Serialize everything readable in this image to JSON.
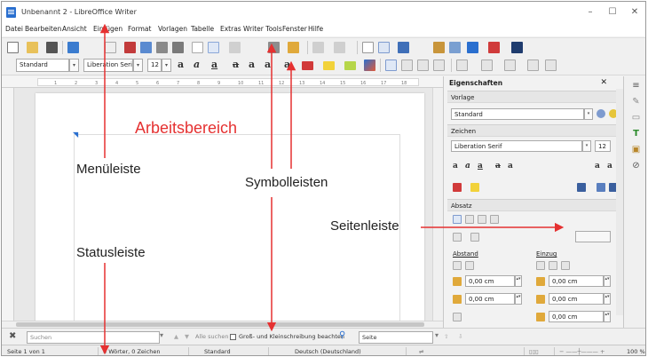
{
  "window": {
    "title": "Unbenannt 2 - LibreOffice Writer",
    "minimize": "–",
    "maximize": "☐",
    "close": "✕"
  },
  "menubar": {
    "items": [
      "Datei",
      "Bearbeiten",
      "Ansicht",
      "Einfügen",
      "Format",
      "Vorlagen",
      "Tabelle",
      "Extras",
      "Writer Tools",
      "Fenster",
      "Hilfe"
    ]
  },
  "format_toolbar": {
    "paragraph_style": "Standard",
    "font_name": "Liberation Serif",
    "font_size": "12"
  },
  "ruler": {
    "numbers": [
      "1",
      "2",
      "3",
      "4",
      "5",
      "6",
      "7",
      "8",
      "9",
      "10",
      "11",
      "12",
      "13",
      "14",
      "15",
      "16",
      "17",
      "18"
    ]
  },
  "sidebar": {
    "title": "Eigenschaften",
    "close": "✕",
    "sections": {
      "styles": "Vorlage",
      "character": "Zeichen",
      "paragraph": "Absatz"
    },
    "style_value": "Standard",
    "font_value": "Liberation Serif",
    "font_size_value": "12",
    "spacing_label": "Abstand",
    "indent_label": "Einzug",
    "spacing_above": "0,00 cm",
    "spacing_below": "0,00 cm",
    "indent_before": "0,00 cm",
    "indent_after": "0,00 cm",
    "indent_first": "0,00 cm"
  },
  "find_toolbar": {
    "search_placeholder": "Suchen",
    "find_all": "Alle suchen",
    "match_case": "Groß- und Kleinschreibung beachten",
    "nav_target": "Seite"
  },
  "statusbar": {
    "page": "Seite 1 von 1",
    "words": "0 Wörter, 0 Zeichen",
    "page_style": "Standard",
    "language": "Deutsch (Deutschland)",
    "zoom": "100 %"
  },
  "annotations": {
    "workspace": "Arbeitsbereich",
    "menubar": "Menüleiste",
    "toolbars": "Symbolleisten",
    "sidebar": "Seitenleiste",
    "statusbar": "Statusleiste"
  },
  "colors": {
    "annotation_red": "#e53131",
    "accent_blue": "#2a6fcf"
  }
}
